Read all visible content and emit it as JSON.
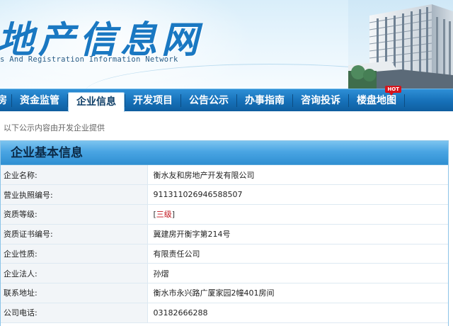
{
  "banner": {
    "title": "地产信息网",
    "subtitle": "s And Registration Information Network"
  },
  "nav": {
    "items": [
      {
        "label": "房",
        "active": false
      },
      {
        "label": "资金监管",
        "active": false
      },
      {
        "label": "企业信息",
        "active": true
      },
      {
        "label": "开发项目",
        "active": false
      },
      {
        "label": "公告公示",
        "active": false
      },
      {
        "label": "办事指南",
        "active": false
      },
      {
        "label": "咨询投诉",
        "active": false
      },
      {
        "label": "楼盘地图",
        "active": false,
        "badge": "HOT"
      }
    ]
  },
  "notice": "以下公示内容由开发企业提供",
  "panel": {
    "title": "企业基本信息",
    "rows": [
      {
        "label": "企业名称:",
        "value": "衡水友和房地产开发有限公司"
      },
      {
        "label": "营业执照编号:",
        "value": "911311026946588507"
      },
      {
        "label": "资质等级:",
        "value": "三级",
        "bracket_open": "[",
        "bracket_close": "]"
      },
      {
        "label": "资质证书编号:",
        "value": "冀建房开衡字第214号"
      },
      {
        "label": "企业性质:",
        "value": "有限责任公司"
      },
      {
        "label": "企业法人:",
        "value": "孙熠"
      },
      {
        "label": "联系地址:",
        "value": "衡水市永兴路广厦家园2幢401房间"
      },
      {
        "label": "公司电话:",
        "value": "03182666288"
      }
    ]
  },
  "colors": {
    "brand_blue": "#1a78c2",
    "nav_blue": "#1670b8",
    "hot_red": "#d6141c",
    "grade_red": "#c1121a"
  }
}
